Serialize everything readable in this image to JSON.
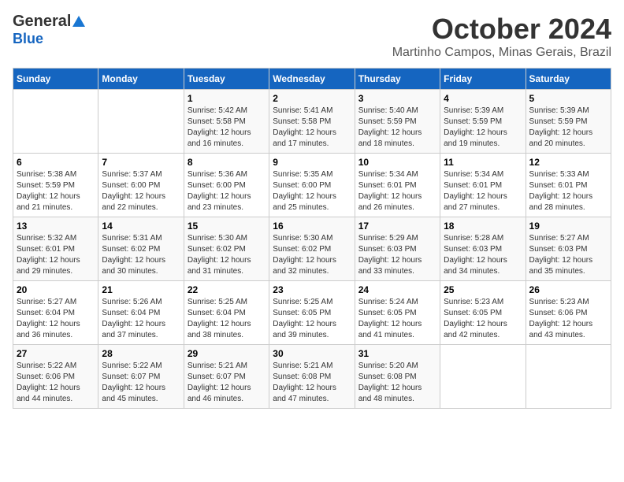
{
  "logo": {
    "general": "General",
    "blue": "Blue"
  },
  "title": "October 2024",
  "location": "Martinho Campos, Minas Gerais, Brazil",
  "headers": [
    "Sunday",
    "Monday",
    "Tuesday",
    "Wednesday",
    "Thursday",
    "Friday",
    "Saturday"
  ],
  "weeks": [
    [
      {
        "day": "",
        "sunrise": "",
        "sunset": "",
        "daylight": ""
      },
      {
        "day": "",
        "sunrise": "",
        "sunset": "",
        "daylight": ""
      },
      {
        "day": "1",
        "sunrise": "Sunrise: 5:42 AM",
        "sunset": "Sunset: 5:58 PM",
        "daylight": "Daylight: 12 hours and 16 minutes."
      },
      {
        "day": "2",
        "sunrise": "Sunrise: 5:41 AM",
        "sunset": "Sunset: 5:58 PM",
        "daylight": "Daylight: 12 hours and 17 minutes."
      },
      {
        "day": "3",
        "sunrise": "Sunrise: 5:40 AM",
        "sunset": "Sunset: 5:59 PM",
        "daylight": "Daylight: 12 hours and 18 minutes."
      },
      {
        "day": "4",
        "sunrise": "Sunrise: 5:39 AM",
        "sunset": "Sunset: 5:59 PM",
        "daylight": "Daylight: 12 hours and 19 minutes."
      },
      {
        "day": "5",
        "sunrise": "Sunrise: 5:39 AM",
        "sunset": "Sunset: 5:59 PM",
        "daylight": "Daylight: 12 hours and 20 minutes."
      }
    ],
    [
      {
        "day": "6",
        "sunrise": "Sunrise: 5:38 AM",
        "sunset": "Sunset: 5:59 PM",
        "daylight": "Daylight: 12 hours and 21 minutes."
      },
      {
        "day": "7",
        "sunrise": "Sunrise: 5:37 AM",
        "sunset": "Sunset: 6:00 PM",
        "daylight": "Daylight: 12 hours and 22 minutes."
      },
      {
        "day": "8",
        "sunrise": "Sunrise: 5:36 AM",
        "sunset": "Sunset: 6:00 PM",
        "daylight": "Daylight: 12 hours and 23 minutes."
      },
      {
        "day": "9",
        "sunrise": "Sunrise: 5:35 AM",
        "sunset": "Sunset: 6:00 PM",
        "daylight": "Daylight: 12 hours and 25 minutes."
      },
      {
        "day": "10",
        "sunrise": "Sunrise: 5:34 AM",
        "sunset": "Sunset: 6:01 PM",
        "daylight": "Daylight: 12 hours and 26 minutes."
      },
      {
        "day": "11",
        "sunrise": "Sunrise: 5:34 AM",
        "sunset": "Sunset: 6:01 PM",
        "daylight": "Daylight: 12 hours and 27 minutes."
      },
      {
        "day": "12",
        "sunrise": "Sunrise: 5:33 AM",
        "sunset": "Sunset: 6:01 PM",
        "daylight": "Daylight: 12 hours and 28 minutes."
      }
    ],
    [
      {
        "day": "13",
        "sunrise": "Sunrise: 5:32 AM",
        "sunset": "Sunset: 6:01 PM",
        "daylight": "Daylight: 12 hours and 29 minutes."
      },
      {
        "day": "14",
        "sunrise": "Sunrise: 5:31 AM",
        "sunset": "Sunset: 6:02 PM",
        "daylight": "Daylight: 12 hours and 30 minutes."
      },
      {
        "day": "15",
        "sunrise": "Sunrise: 5:30 AM",
        "sunset": "Sunset: 6:02 PM",
        "daylight": "Daylight: 12 hours and 31 minutes."
      },
      {
        "day": "16",
        "sunrise": "Sunrise: 5:30 AM",
        "sunset": "Sunset: 6:02 PM",
        "daylight": "Daylight: 12 hours and 32 minutes."
      },
      {
        "day": "17",
        "sunrise": "Sunrise: 5:29 AM",
        "sunset": "Sunset: 6:03 PM",
        "daylight": "Daylight: 12 hours and 33 minutes."
      },
      {
        "day": "18",
        "sunrise": "Sunrise: 5:28 AM",
        "sunset": "Sunset: 6:03 PM",
        "daylight": "Daylight: 12 hours and 34 minutes."
      },
      {
        "day": "19",
        "sunrise": "Sunrise: 5:27 AM",
        "sunset": "Sunset: 6:03 PM",
        "daylight": "Daylight: 12 hours and 35 minutes."
      }
    ],
    [
      {
        "day": "20",
        "sunrise": "Sunrise: 5:27 AM",
        "sunset": "Sunset: 6:04 PM",
        "daylight": "Daylight: 12 hours and 36 minutes."
      },
      {
        "day": "21",
        "sunrise": "Sunrise: 5:26 AM",
        "sunset": "Sunset: 6:04 PM",
        "daylight": "Daylight: 12 hours and 37 minutes."
      },
      {
        "day": "22",
        "sunrise": "Sunrise: 5:25 AM",
        "sunset": "Sunset: 6:04 PM",
        "daylight": "Daylight: 12 hours and 38 minutes."
      },
      {
        "day": "23",
        "sunrise": "Sunrise: 5:25 AM",
        "sunset": "Sunset: 6:05 PM",
        "daylight": "Daylight: 12 hours and 39 minutes."
      },
      {
        "day": "24",
        "sunrise": "Sunrise: 5:24 AM",
        "sunset": "Sunset: 6:05 PM",
        "daylight": "Daylight: 12 hours and 41 minutes."
      },
      {
        "day": "25",
        "sunrise": "Sunrise: 5:23 AM",
        "sunset": "Sunset: 6:05 PM",
        "daylight": "Daylight: 12 hours and 42 minutes."
      },
      {
        "day": "26",
        "sunrise": "Sunrise: 5:23 AM",
        "sunset": "Sunset: 6:06 PM",
        "daylight": "Daylight: 12 hours and 43 minutes."
      }
    ],
    [
      {
        "day": "27",
        "sunrise": "Sunrise: 5:22 AM",
        "sunset": "Sunset: 6:06 PM",
        "daylight": "Daylight: 12 hours and 44 minutes."
      },
      {
        "day": "28",
        "sunrise": "Sunrise: 5:22 AM",
        "sunset": "Sunset: 6:07 PM",
        "daylight": "Daylight: 12 hours and 45 minutes."
      },
      {
        "day": "29",
        "sunrise": "Sunrise: 5:21 AM",
        "sunset": "Sunset: 6:07 PM",
        "daylight": "Daylight: 12 hours and 46 minutes."
      },
      {
        "day": "30",
        "sunrise": "Sunrise: 5:21 AM",
        "sunset": "Sunset: 6:08 PM",
        "daylight": "Daylight: 12 hours and 47 minutes."
      },
      {
        "day": "31",
        "sunrise": "Sunrise: 5:20 AM",
        "sunset": "Sunset: 6:08 PM",
        "daylight": "Daylight: 12 hours and 48 minutes."
      },
      {
        "day": "",
        "sunrise": "",
        "sunset": "",
        "daylight": ""
      },
      {
        "day": "",
        "sunrise": "",
        "sunset": "",
        "daylight": ""
      }
    ]
  ]
}
